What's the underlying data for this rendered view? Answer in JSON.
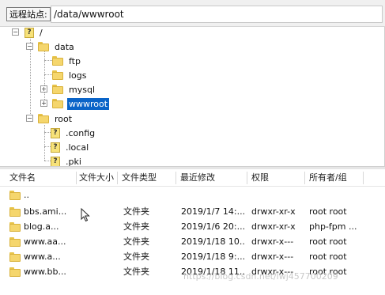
{
  "remote_site": {
    "label": "远程站点:",
    "path": "/data/wwwroot"
  },
  "tree": {
    "root_label": "/",
    "data_label": "data",
    "ftp_label": "ftp",
    "logs_label": "logs",
    "mysql_label": "mysql",
    "wwwroot_label": "wwwroot",
    "rootdir_label": "root",
    "config_label": ".config",
    "local_label": ".local",
    "pki_label": ".pki"
  },
  "file_list": {
    "columns": [
      "文件名",
      "文件大小",
      "文件类型",
      "最近修改",
      "权限",
      "所有者/组"
    ],
    "rows": [
      {
        "name": "..",
        "size": "",
        "type": "",
        "modified": "",
        "perms": "",
        "owner": ""
      },
      {
        "name": "bbs.ami...",
        "size": "",
        "type": "文件夹",
        "modified": "2019/1/7 14:...",
        "perms": "drwxr-xr-x",
        "owner": "root root"
      },
      {
        "name": "blog.a...",
        "size": "",
        "type": "文件夹",
        "modified": "2019/1/6 20:...",
        "perms": "drwxr-xr-x",
        "owner": "php-fpm ..."
      },
      {
        "name": "www.aa...",
        "size": "",
        "type": "文件夹",
        "modified": "2019/1/18 10...",
        "perms": "drwxr-x---",
        "owner": "root root"
      },
      {
        "name": "www.a...",
        "size": "",
        "type": "文件夹",
        "modified": "2019/1/18 9:...",
        "perms": "drwxr-x---",
        "owner": "root root"
      },
      {
        "name": "www.bb...",
        "size": "",
        "type": "文件夹",
        "modified": "2019/1/18 11...",
        "perms": "drwxr-x---",
        "owner": "root root"
      }
    ]
  },
  "watermark": "https://blog.csdn.net/lwj457700209",
  "colors": {
    "selection": "#0a64c8",
    "folder": "#f5d66d"
  }
}
